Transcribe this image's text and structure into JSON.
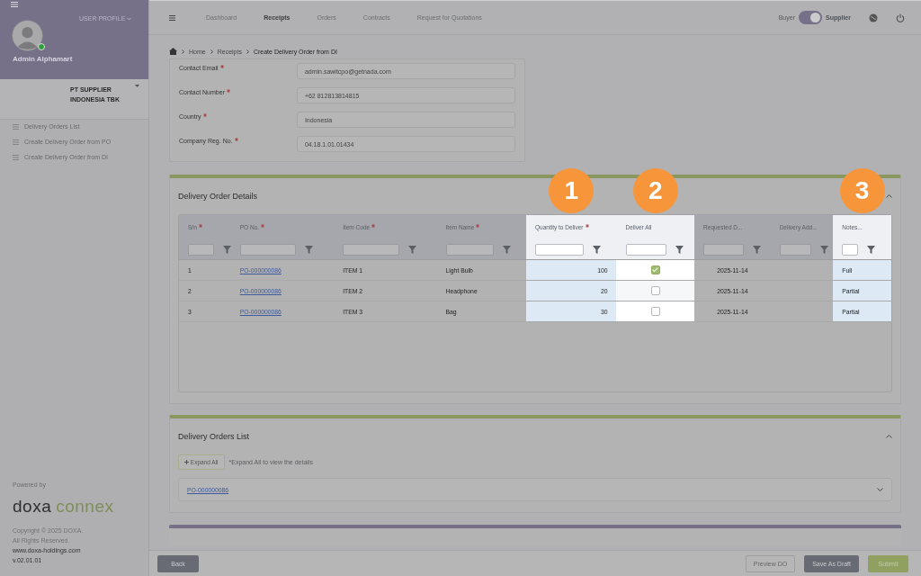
{
  "sidebar": {
    "profile_label": "USER PROFILE",
    "user_name": "Admin Alphamart",
    "online": true,
    "company": "PT SUPPLIER INDONESIA TBK",
    "items": [
      {
        "label": "Delivery Orders List"
      },
      {
        "label": "Create Delivery Order from PO"
      },
      {
        "label": "Create Delivery Order from DI"
      }
    ],
    "powered_by": "Powered by",
    "logo": {
      "part_1": "doxa",
      "part_2": "connex"
    },
    "footer_lines": [
      "Copyright © 2025 DOXA.",
      "All Rights Reserved.",
      "www.doxa-holdings.com",
      "v.02.01.01"
    ]
  },
  "nav": {
    "items": [
      {
        "label": "Dashboard",
        "selected": false
      },
      {
        "label": "Receipts",
        "selected": true
      },
      {
        "label": "Orders",
        "selected": false
      },
      {
        "label": "Contracts",
        "selected": false
      },
      {
        "label": "Request for Quotations",
        "selected": false
      }
    ],
    "toggle": {
      "left": "Buyer",
      "right": "Supplier",
      "on": true
    }
  },
  "breadcrumb": [
    "Home",
    "Receipts",
    "Create Delivery Order from DI"
  ],
  "contact_fields": [
    {
      "label": "Contact Email",
      "required": true,
      "value": "admin.sawitcpo@getnada.com"
    },
    {
      "label": "Contact Number",
      "required": true,
      "value": "+62 812813814815"
    },
    {
      "label": "Country",
      "required": true,
      "value": "Indonesia"
    },
    {
      "label": "Company Reg. No.",
      "required": true,
      "value": "04.18.1.01.01434"
    }
  ],
  "details": {
    "title": "Delivery Order Details",
    "columns": [
      {
        "label": "S/n",
        "required": true,
        "highlighted": false
      },
      {
        "label": "PO No.",
        "required": true,
        "highlighted": false
      },
      {
        "label": "Item Code",
        "required": true,
        "highlighted": false
      },
      {
        "label": "Item Name",
        "required": true,
        "highlighted": false
      },
      {
        "label": "Quantity to Deliver",
        "required": true,
        "highlighted": true,
        "badge": "1"
      },
      {
        "label": "Deliver All",
        "required": false,
        "highlighted": true,
        "badge": "2"
      },
      {
        "label": "Requested D...",
        "required": false,
        "highlighted": false
      },
      {
        "label": "Delivery Add...",
        "required": false,
        "highlighted": false
      },
      {
        "label": "Notes...",
        "required": false,
        "highlighted": true,
        "badge": "3"
      }
    ],
    "rows": [
      {
        "sn": "1",
        "po": "PO-000000086",
        "code": "ITEM 1",
        "name": "Light Bulb",
        "qty": "100",
        "deliver_all": true,
        "requested": "2025-11-14",
        "notes": "Full"
      },
      {
        "sn": "2",
        "po": "PO-000000086",
        "code": "ITEM 2",
        "name": "Headphone",
        "qty": "20",
        "deliver_all": false,
        "requested": "2025-11-14",
        "notes": "Partial"
      },
      {
        "sn": "3",
        "po": "PO-000000086",
        "code": "ITEM 3",
        "name": "Bag",
        "qty": "30",
        "deliver_all": false,
        "requested": "2025-11-14",
        "notes": "Partial"
      }
    ]
  },
  "orders_list": {
    "title": "Delivery Orders List",
    "expand_button": "Expand All",
    "hint": "*Expand All to view the details",
    "items": [
      {
        "label": "PO-000000086"
      }
    ]
  },
  "footer_buttons": [
    {
      "label": "Back",
      "kind": "dark"
    },
    {
      "label": "Preview DO",
      "kind": "outline"
    },
    {
      "label": "Save As Draft",
      "kind": "dark"
    },
    {
      "label": "Submit",
      "kind": "green"
    }
  ]
}
